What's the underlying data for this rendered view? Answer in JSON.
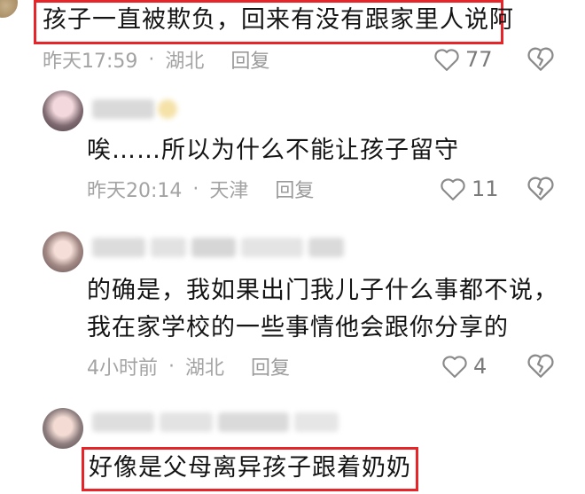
{
  "comments": [
    {
      "text": "孩子一直被欺负，回来有没有跟家里人说阿",
      "time": "昨天17:59",
      "location": "湖北",
      "reply": "回复",
      "likes": "77"
    },
    {
      "lines": [
        "唉……所以为什么不能让孩子留守"
      ],
      "time": "昨天20:14",
      "location": "天津",
      "reply": "回复",
      "likes": "11"
    },
    {
      "lines": [
        "的确是，我如果出门我儿子什么事都不说，",
        "我在家学校的一些事情他会跟你分享的"
      ],
      "time": "4小时前",
      "location": "湖北",
      "reply": "回复",
      "likes": "4"
    },
    {
      "text": "好像是父母离异孩子跟着奶奶"
    }
  ],
  "icons": [
    "heart-icon",
    "broken-heart-icon"
  ],
  "colors": {
    "highlight": "#e5252a",
    "meta": "#a3a3a3"
  }
}
